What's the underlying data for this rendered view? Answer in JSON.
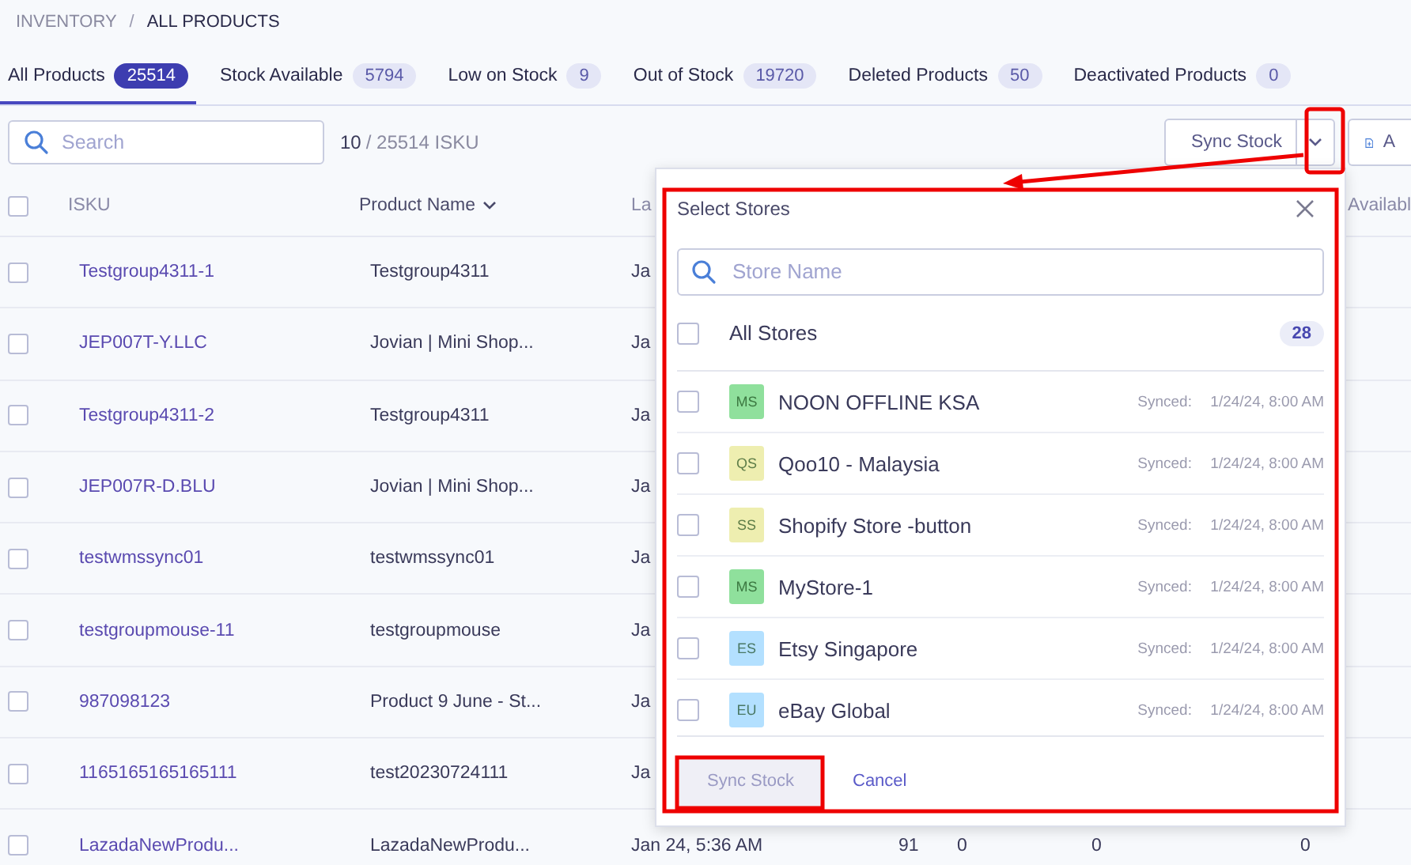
{
  "breadcrumb": {
    "parent": "INVENTORY",
    "separator": "/",
    "current": "ALL PRODUCTS"
  },
  "tabs": [
    {
      "label": "All Products",
      "count": "25514",
      "selected": true
    },
    {
      "label": "Stock Available",
      "count": "5794",
      "selected": false
    },
    {
      "label": "Low on Stock",
      "count": "9",
      "selected": false
    },
    {
      "label": "Out of Stock",
      "count": "19720",
      "selected": false
    },
    {
      "label": "Deleted Products",
      "count": "50",
      "selected": false
    },
    {
      "label": "Deactivated Products",
      "count": "0",
      "selected": false
    }
  ],
  "toolbar": {
    "search": {
      "placeholder": "Search"
    },
    "shown": "10",
    "total": "/ 25514 ISKU",
    "sync_button": "Sync Stock",
    "add_button": "A"
  },
  "table": {
    "all_checked": false,
    "columns": [
      {
        "label": "ISKU",
        "sortable": false
      },
      {
        "label": "Product Name",
        "sortable": true
      },
      {
        "label": "La",
        "sortable": false
      },
      {
        "label": "Availabl",
        "sortable": false
      }
    ],
    "rows": [
      {
        "checked": false,
        "cells": [
          "Testgroup4311-1",
          "Testgroup4311",
          "Ja"
        ]
      },
      {
        "checked": false,
        "cells": [
          "JEP007T-Y.LLC",
          "Jovian | Mini Shop...",
          "Ja"
        ]
      },
      {
        "checked": false,
        "cells": [
          "Testgroup4311-2",
          "Testgroup4311",
          "Ja"
        ]
      },
      {
        "checked": false,
        "cells": [
          "JEP007R-D.BLU",
          "Jovian | Mini Shop...",
          "Ja"
        ]
      },
      {
        "checked": false,
        "cells": [
          "testwmssync01",
          "testwmssync01",
          "Ja"
        ]
      },
      {
        "checked": false,
        "cells": [
          "testgroupmouse-11",
          "testgroupmouse",
          "Ja"
        ]
      },
      {
        "checked": false,
        "cells": [
          "987098123",
          "Product 9 June - St...",
          "Ja"
        ]
      },
      {
        "checked": false,
        "cells": [
          "1165165165165111",
          "test20230724111",
          "Ja"
        ]
      },
      {
        "checked": false,
        "cells": [
          "LazadaNewProdu...",
          "LazadaNewProdu...",
          "Jan 24, 5:36 AM",
          "91",
          "0",
          "0",
          "0"
        ]
      }
    ]
  },
  "popup": {
    "title": "Select Stores",
    "search": {
      "placeholder": "Store Name"
    },
    "all_stores": {
      "label": "All Stores",
      "count": "28",
      "checked": false
    },
    "stores": [
      {
        "initials": "MS",
        "name": "NOON OFFLINE KSA",
        "status": "Synced:",
        "time": "1/24/24, 8:00 AM",
        "color": "#8fe09c",
        "checked": false
      },
      {
        "initials": "QS",
        "name": "Qoo10 - Malaysia",
        "status": "Synced:",
        "time": "1/24/24, 8:00 AM",
        "color": "#eeeeb0",
        "checked": false
      },
      {
        "initials": "SS",
        "name": "Shopify Store -button",
        "status": "Synced:",
        "time": "1/24/24, 8:00 AM",
        "color": "#eeeeb0",
        "checked": false
      },
      {
        "initials": "MS",
        "name": "MyStore-1",
        "status": "Synced:",
        "time": "1/24/24, 8:00 AM",
        "color": "#8fe09c",
        "checked": false
      },
      {
        "initials": "ES",
        "name": "Etsy Singapore",
        "status": "Synced:",
        "time": "1/24/24, 8:00 AM",
        "color": "#b3e0ff",
        "checked": false
      },
      {
        "initials": "EU",
        "name": "eBay Global",
        "status": "Synced:",
        "time": "1/24/24, 8:00 AM",
        "color": "#b3e0ff",
        "checked": false
      }
    ],
    "confirm_button": {
      "label": "Sync Stock",
      "disabled": true
    },
    "cancel": "Cancel"
  }
}
